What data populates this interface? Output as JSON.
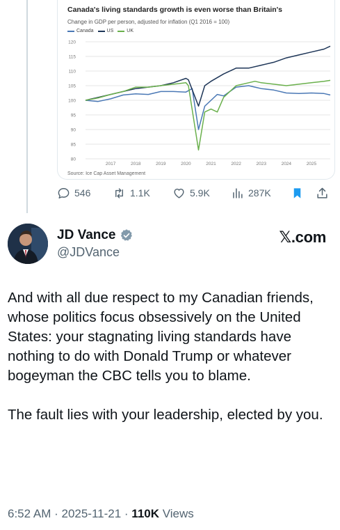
{
  "chart_data": {
    "type": "line",
    "title": "Canada's living standards growth is even worse than Britain's",
    "subtitle": "Change in GDP per person, adjusted for inflation (Q1 2016 = 100)",
    "source": "Source: Ice Cap Asset Management",
    "ylim": [
      80,
      120
    ],
    "yticks": [
      80,
      85,
      90,
      95,
      100,
      105,
      110,
      115,
      120
    ],
    "xticks": [
      "2017",
      "2018",
      "2019",
      "2020",
      "2021",
      "2022",
      "2023",
      "2024",
      "2025"
    ],
    "xlim": [
      2016.0,
      2025.75
    ],
    "grid": true,
    "legend_position": "top-left",
    "series": [
      {
        "name": "Canada",
        "color": "#4a78b5",
        "points": [
          [
            2016.0,
            100
          ],
          [
            2016.5,
            99.6
          ],
          [
            2017.0,
            100.5
          ],
          [
            2017.5,
            101.8
          ],
          [
            2018.0,
            102.2
          ],
          [
            2018.5,
            102.0
          ],
          [
            2019.0,
            103.0
          ],
          [
            2019.5,
            103.0
          ],
          [
            2020.0,
            102.8
          ],
          [
            2020.25,
            104
          ],
          [
            2020.5,
            90
          ],
          [
            2020.75,
            98
          ],
          [
            2021.0,
            100
          ],
          [
            2021.25,
            102
          ],
          [
            2021.5,
            101.5
          ],
          [
            2021.75,
            103
          ],
          [
            2022.0,
            104.5
          ],
          [
            2022.5,
            105
          ],
          [
            2022.75,
            104.5
          ],
          [
            2023.0,
            104
          ],
          [
            2023.5,
            103.5
          ],
          [
            2024.0,
            102.5
          ],
          [
            2024.5,
            102.3
          ],
          [
            2025.0,
            102.5
          ],
          [
            2025.5,
            102.3
          ],
          [
            2025.75,
            101.8
          ]
        ]
      },
      {
        "name": "US",
        "color": "#1d3557",
        "points": [
          [
            2016.0,
            100
          ],
          [
            2016.5,
            101
          ],
          [
            2017.0,
            102
          ],
          [
            2017.5,
            103
          ],
          [
            2018.0,
            104
          ],
          [
            2018.5,
            104.5
          ],
          [
            2019.0,
            105
          ],
          [
            2019.5,
            106
          ],
          [
            2020.0,
            107.5
          ],
          [
            2020.1,
            107
          ],
          [
            2020.5,
            98
          ],
          [
            2020.75,
            105
          ],
          [
            2021.0,
            106.5
          ],
          [
            2021.5,
            109
          ],
          [
            2022.0,
            111
          ],
          [
            2022.5,
            111
          ],
          [
            2023.0,
            112
          ],
          [
            2023.5,
            113
          ],
          [
            2024.0,
            114.5
          ],
          [
            2024.5,
            115.5
          ],
          [
            2025.0,
            116.5
          ],
          [
            2025.5,
            117.5
          ],
          [
            2025.75,
            118.5
          ]
        ]
      },
      {
        "name": "UK",
        "color": "#6ab04c",
        "points": [
          [
            2016.0,
            100
          ],
          [
            2016.5,
            100.8
          ],
          [
            2017.0,
            102
          ],
          [
            2017.5,
            103
          ],
          [
            2018.0,
            104.5
          ],
          [
            2018.5,
            104.5
          ],
          [
            2019.0,
            105
          ],
          [
            2019.5,
            105.5
          ],
          [
            2020.0,
            106
          ],
          [
            2020.1,
            105
          ],
          [
            2020.5,
            83
          ],
          [
            2020.75,
            96
          ],
          [
            2021.0,
            97
          ],
          [
            2021.25,
            96
          ],
          [
            2021.5,
            101
          ],
          [
            2022.0,
            105
          ],
          [
            2022.5,
            106
          ],
          [
            2022.75,
            106.5
          ],
          [
            2023.0,
            106
          ],
          [
            2023.5,
            105.5
          ],
          [
            2024.0,
            105
          ],
          [
            2024.5,
            105.5
          ],
          [
            2025.0,
            106
          ],
          [
            2025.5,
            106.5
          ],
          [
            2025.75,
            106.8
          ]
        ]
      }
    ]
  },
  "actions": {
    "reply_count": "546",
    "retweet_count": "1.1K",
    "like_count": "5.9K",
    "views_count": "287K"
  },
  "author": {
    "name": "JD Vance",
    "handle": "@JDVance"
  },
  "watermark": {
    "x_glyph": "𝕏",
    "suffix": ".com"
  },
  "post": {
    "paragraph1": "And with all due respect to my Canadian friends, whose politics focus obsessively on the United States: your stagnating living standards have nothing to do with Donald Trump or whatever bogeyman the CBC tells you to blame.",
    "paragraph2": "The fault lies with your leadership, elected by you."
  },
  "meta": {
    "time": "6:52 AM",
    "separator": " · ",
    "date": "2025-11-21",
    "views_value": "110K",
    "views_label": "Views"
  },
  "colors": {
    "muted": "#536471",
    "bookmark": "#1d9bf0",
    "verified": "#829aab"
  }
}
